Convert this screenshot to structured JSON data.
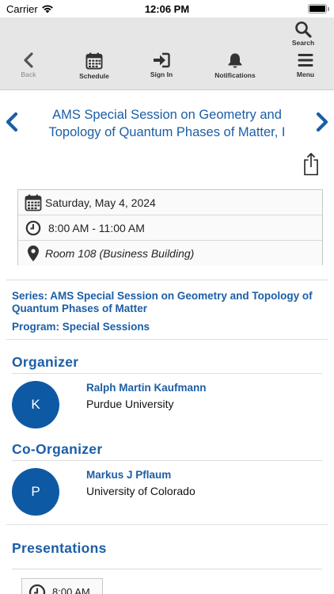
{
  "status_bar": {
    "carrier": "Carrier",
    "time": "12:06 PM"
  },
  "toolbar": {
    "search_label": "Search",
    "back_label": "Back",
    "schedule_label": "Schedule",
    "signin_label": "Sign In",
    "notifications_label": "Notifications",
    "menu_label": "Menu"
  },
  "session": {
    "title": "AMS Special Session on Geometry and Topology of Quantum Phases of Matter, I",
    "date": "Saturday, May 4, 2024",
    "time": "8:00 AM - 11:00 AM",
    "room": "Room 108 (Business Building)",
    "series": "Series: AMS Special Session on Geometry and Topology of Quantum Phases of Matter",
    "program": "Program: Special Sessions"
  },
  "organizer": {
    "heading": "Organizer",
    "initial": "K",
    "name": "Ralph Martin Kaufmann",
    "affiliation": "Purdue University"
  },
  "co_organizer": {
    "heading": "Co-Organizer",
    "initial": "P",
    "name": "Markus J Pflaum",
    "affiliation": "University of Colorado"
  },
  "presentations": {
    "heading": "Presentations",
    "first_time": "8:00 AM"
  },
  "colors": {
    "accent": "#1b5ea6",
    "avatar": "#0e59a4",
    "toolbar_bg": "#e6e6e6"
  },
  "icons": [
    "wifi-icon",
    "battery-icon",
    "search-icon",
    "back-icon",
    "calendar-icon",
    "sign-in-icon",
    "bell-icon",
    "menu-icon",
    "chevron-left-icon",
    "chevron-right-icon",
    "share-icon",
    "clock-icon",
    "map-pin-icon"
  ]
}
